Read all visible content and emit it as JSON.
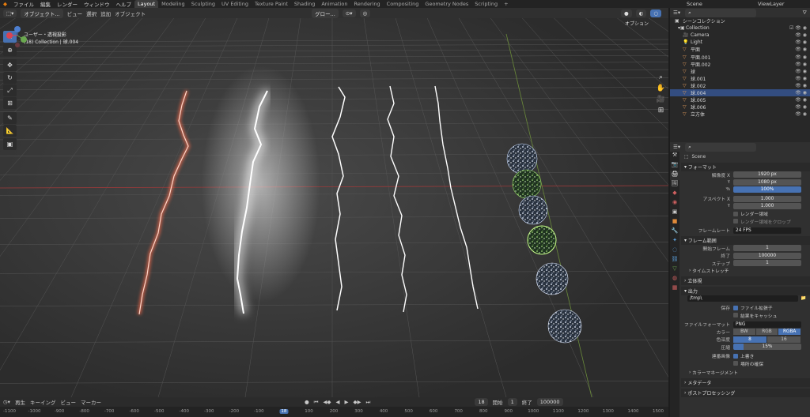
{
  "topbar": {
    "menus": [
      "ファイル",
      "編集",
      "レンダー",
      "ウィンドウ",
      "ヘルプ"
    ],
    "workspaces": [
      "Layout",
      "Modeling",
      "Sculpting",
      "UV Editing",
      "Texture Paint",
      "Shading",
      "Animation",
      "Rendering",
      "Compositing",
      "Geometry Nodes",
      "Scripting"
    ],
    "add_tab": "+",
    "scene": "Scene",
    "view_layer": "ViewLayer"
  },
  "viewport_header": {
    "mode": "オブジェクト...",
    "view": "ビュー",
    "select": "選択",
    "add": "追加",
    "object": "オブジェクト",
    "orientation": "グロー...",
    "options": "オプション"
  },
  "viewport_info": {
    "line1": "ユーザー・透視投影",
    "line2": "(18) Collection | 球.004"
  },
  "outliner": {
    "title": "シーンコレクション",
    "collection": "Collection",
    "items": [
      "Camera",
      "Light",
      "平面",
      "平面.001",
      "平面.002",
      "球",
      "球.001",
      "球.002",
      "球.004",
      "球.005",
      "球.006",
      "立方体"
    ]
  },
  "properties": {
    "scene": "Scene",
    "format_section": "フォーマット",
    "res_x_label": "解像度 X",
    "res_x": "1920 px",
    "res_y_label": "Y",
    "res_y": "1080 px",
    "pct_label": "%",
    "pct": "100%",
    "aspect_x_label": "アスペクト X",
    "aspect_x": "1.000",
    "aspect_y_label": "Y",
    "aspect_y": "1.000",
    "render_region": "レンダー領域",
    "crop_region": "レンダー領域をクロップ",
    "fps_label": "フレームレート",
    "fps": "24 FPS",
    "frame_section": "フレーム範囲",
    "start_label": "開始フレーム",
    "start": "1",
    "end_label": "終了",
    "end": "100000",
    "step_label": "ステップ",
    "step": "1",
    "time_stretch": "タイムストレッチ",
    "stereo": "立体視",
    "output_section": "出力",
    "output_path": "/tmp\\",
    "save_label": "保存",
    "file_ext": "ファイル拡張子",
    "cache": "結果をキャッシュ",
    "file_format_label": "ファイルフォーマット",
    "file_format": "PNG",
    "color_label": "カラー",
    "color_opts": [
      "BW",
      "RGB",
      "RGBA"
    ],
    "depth_label": "色深度",
    "depth_opts": [
      "8",
      "16"
    ],
    "compress_label": "圧縮",
    "compress": "15%",
    "sequence_label": "連番画像",
    "overwrite": "上書き",
    "placeholder": "場所の確保",
    "color_mgmt": "カラーマネージメント",
    "metadata": "メタデータ",
    "postprocess": "ポストプロセッシング"
  },
  "timeline": {
    "playback": "再生",
    "keying": "キーイング",
    "view": "ビュー",
    "marker": "マーカー",
    "current": "18",
    "start_label": "開始",
    "start": "1",
    "end_label": "終了",
    "end": "100000",
    "ticks": [
      "-1100",
      "-1000",
      "-900",
      "-800",
      "-700",
      "-600",
      "-500",
      "-400",
      "-300",
      "-200",
      "-100",
      "18",
      "100",
      "200",
      "300",
      "400",
      "500",
      "600",
      "700",
      "800",
      "900",
      "1000",
      "1100",
      "1200",
      "1300",
      "1400",
      "1500"
    ]
  },
  "colors": {
    "accent": "#4772b3",
    "bolt_red": "#ff6a4a",
    "bolt_white": "#ffffff",
    "sphere_green": "#9be06a"
  }
}
